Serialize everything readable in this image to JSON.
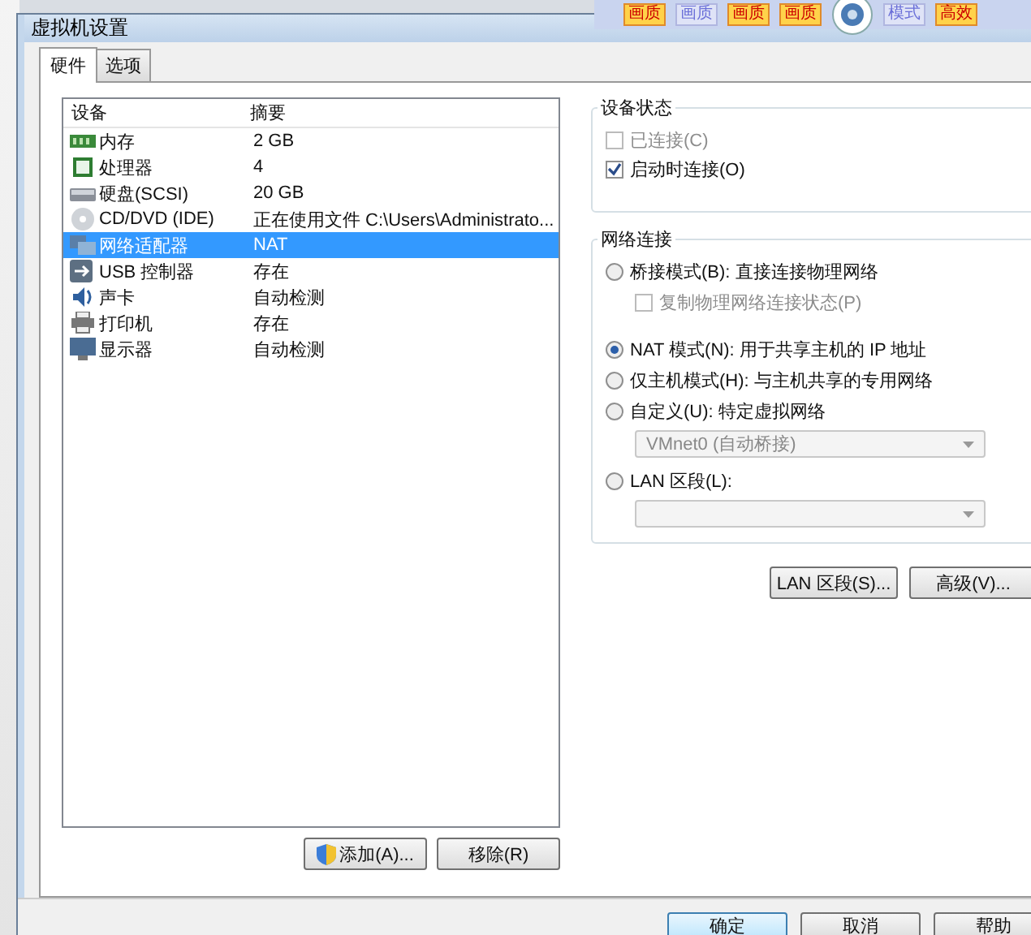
{
  "toolbar": {
    "buttons": [
      {
        "label": "画质",
        "selected": true
      },
      {
        "label": "画质",
        "selected": false
      },
      {
        "label": "画质",
        "selected": true
      },
      {
        "label": "画质",
        "selected": true
      },
      {
        "label": "模式",
        "selected": false
      },
      {
        "label": "高效",
        "selected": true
      }
    ]
  },
  "window": {
    "title": "虚拟机设置"
  },
  "tabs": [
    {
      "label": "硬件",
      "selected": true
    },
    {
      "label": "选项",
      "selected": false
    }
  ],
  "devices": {
    "columns": [
      "设备",
      "摘要"
    ],
    "rows": [
      {
        "kind": "memory",
        "device": "内存",
        "summary": "2 GB",
        "selected": false
      },
      {
        "kind": "cpu",
        "device": "处理器",
        "summary": "4",
        "selected": false
      },
      {
        "kind": "disk",
        "device": "硬盘(SCSI)",
        "summary": "20 GB",
        "selected": false
      },
      {
        "kind": "cd",
        "device": "CD/DVD (IDE)",
        "summary": "正在使用文件 C:\\Users\\Administrato...",
        "selected": false
      },
      {
        "kind": "network",
        "device": "网络适配器",
        "summary": "NAT",
        "selected": true
      },
      {
        "kind": "usb",
        "device": "USB 控制器",
        "summary": "存在",
        "selected": false
      },
      {
        "kind": "sound",
        "device": "声卡",
        "summary": "自动检测",
        "selected": false
      },
      {
        "kind": "printer",
        "device": "打印机",
        "summary": "存在",
        "selected": false
      },
      {
        "kind": "display",
        "device": "显示器",
        "summary": "自动检测",
        "selected": false
      }
    ],
    "buttons": [
      "添加(A)...",
      "移除(R)"
    ]
  },
  "device_status": {
    "title": "设备状态",
    "items": [
      {
        "label": "已连接(C)",
        "checked": false,
        "disabled": true
      },
      {
        "label": "启动时连接(O)",
        "checked": true,
        "disabled": false
      }
    ]
  },
  "network_connection": {
    "title": "网络连接",
    "items": [
      {
        "kind": "radio",
        "label": "桥接模式(B): 直接连接物理网络",
        "selected": false,
        "disabled": false
      },
      {
        "kind": "checkbox",
        "label": "复制物理网络连接状态(P)",
        "checked": false,
        "disabled": true
      },
      {
        "kind": "radio",
        "label": "NAT 模式(N): 用于共享主机的 IP 地址",
        "selected": true,
        "disabled": false
      },
      {
        "kind": "radio",
        "label": "仅主机模式(H): 与主机共享的专用网络",
        "selected": false,
        "disabled": false
      },
      {
        "kind": "radio",
        "label": "自定义(U): 特定虚拟网络",
        "selected": false,
        "disabled": false
      },
      {
        "kind": "select",
        "value": "VMnet0 (自动桥接)",
        "disabled": true
      },
      {
        "kind": "radio",
        "label": "LAN 区段(L):",
        "selected": false,
        "disabled": false
      },
      {
        "kind": "select",
        "disabled": true
      }
    ],
    "buttons": [
      "LAN 区段(S)...",
      "高级(V)..."
    ]
  },
  "footer": {
    "buttons": [
      {
        "label": "确定",
        "selected": true
      },
      {
        "label": "取消",
        "selected": false
      },
      {
        "label": "帮助",
        "selected": false
      }
    ]
  }
}
